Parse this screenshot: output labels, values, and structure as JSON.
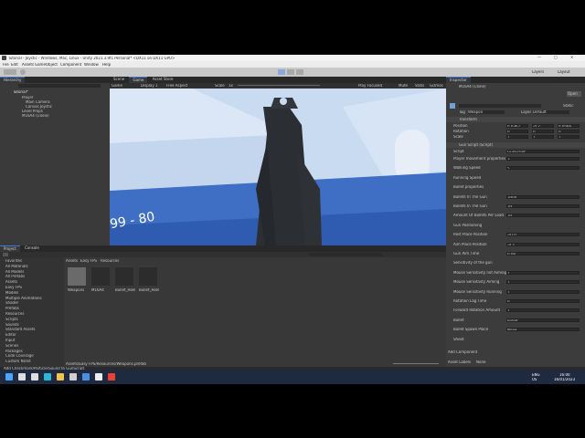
{
  "window": {
    "title": "Tutorial - Joystic - Windows, Mac, Linux - Unity 2021.3.9f1 Personal* <DX11 on DX11 GPU>",
    "controls": [
      "—",
      "□",
      "✕"
    ]
  },
  "menu": [
    "File",
    "Edit",
    "Assets",
    "GameObject",
    "Component",
    "Window",
    "Help"
  ],
  "toolbar": {
    "play_icon": "play-icon",
    "pause_icon": "pause-icon",
    "step_icon": "step-icon",
    "layers_label": "Layers",
    "layout_label": "Layout"
  },
  "hierarchy": {
    "tab": "Hierarchy",
    "items": [
      "Tutorial*",
      "Player",
      "Main Camera",
      "Canvas Joystic",
      "Level Props",
      "M16A4 (Clone)"
    ]
  },
  "scene_view": {
    "tabs": [
      "Scene",
      "Game",
      "Asset Store"
    ],
    "active_tab": "Game",
    "game_label": "Game",
    "display_label": "Display 1",
    "aspect_label": "Free Aspect",
    "scale_label": "Scale",
    "scale_value": "1x",
    "play_focused": "Play Focused",
    "mute_audio": "Mute",
    "stats": "Stats",
    "gizmos": "Gizmos",
    "ammo_text": "99 - 80"
  },
  "project": {
    "tabs": [
      "Project",
      "Console"
    ],
    "tree": [
      "Favorites",
      "All Materials",
      "All Models",
      "All Prefabs",
      "Assets",
      "Easy FPS",
      "Models",
      "Multiple Animations",
      "Shader",
      "Prefabs",
      "Resources",
      "Scripts",
      "Sounds",
      "Standard Assets",
      "Editor",
      "Input",
      "Scenes",
      "Packages",
      "Code Coverage",
      "Custom NUnit"
    ],
    "breadcrumb": [
      "Assets",
      "Easy FPS",
      "Resources"
    ],
    "assets": [
      {
        "label": "Weapons",
        "icon": "folder-icon"
      },
      {
        "label": "M16A4",
        "icon": "weapon-icon"
      },
      {
        "label": "Bullet_Hole",
        "icon": "weapon-icon"
      },
      {
        "label": "Bullet_Hole2",
        "icon": "weapon-icon"
      }
    ],
    "footer_path": "Assets/Easy FPS/Resources/Weapons.prefab",
    "slider_label": "Zoom"
  },
  "inspector": {
    "tabs": [
      "Inspector"
    ],
    "object_name": "M16A4 (Clone)",
    "open_button": "Open",
    "static_label": "Static",
    "tag_label": "Tag",
    "tag_value": "Weapon",
    "layer_label": "Layer",
    "layer_value": "Default",
    "transform_title": "Transform",
    "position_label": "Position",
    "rotation_label": "Rotation",
    "scale_label": "Scale",
    "pos": [
      "0.0367",
      "-0.2",
      "0.0566"
    ],
    "rot": [
      "0",
      "0",
      "0"
    ],
    "scl": [
      "1",
      "1",
      "1"
    ],
    "script_title": "Gun Script (Script)",
    "script_label": "Script",
    "script_value": "GunScript",
    "section_rows": [
      "Player movement properties",
      "Walking Speed",
      "Running Speed",
      "Bullet properties",
      "Bullets In The Gun",
      "Bullets In The Gun",
      "Amount Of Bullets Per Load",
      "Gun Positioning",
      "Rest Place Position",
      "Aim Place Position",
      "Gun Aim Time",
      "Sensitivity of the gun",
      "Mouse Sensitivity not Aiming",
      "Mouse Sensitivity Aiming",
      "Mouse Sensitivity Running",
      "Rotation Lag Time",
      "Forward Rotation Amount",
      "Bullet",
      "Bullet Spawn Place",
      "Shoot"
    ],
    "values": [
      "3",
      "5",
      "",
      "",
      "3000",
      "30",
      "30",
      "",
      "-0.07",
      "-0.2",
      "0.08",
      "",
      "1",
      "1",
      "1",
      "0",
      "1",
      "Bullet",
      "None",
      ""
    ],
    "add_component": "Add Component",
    "bottom_label": "Asset Labels",
    "bottom_value": "None"
  },
  "statusbar": {
    "message": "Add Checkmark/Particle/Sound to GunScript."
  },
  "taskbar": {
    "icons": [
      "windows-icon",
      "search-icon",
      "taskview-icon",
      "edge-icon",
      "explorer-icon",
      "store-icon",
      "mail-icon",
      "unity-icon",
      "chrome-icon"
    ],
    "lang": "ENG",
    "region": "US",
    "time": "16:00",
    "date": "16/01/2023"
  }
}
